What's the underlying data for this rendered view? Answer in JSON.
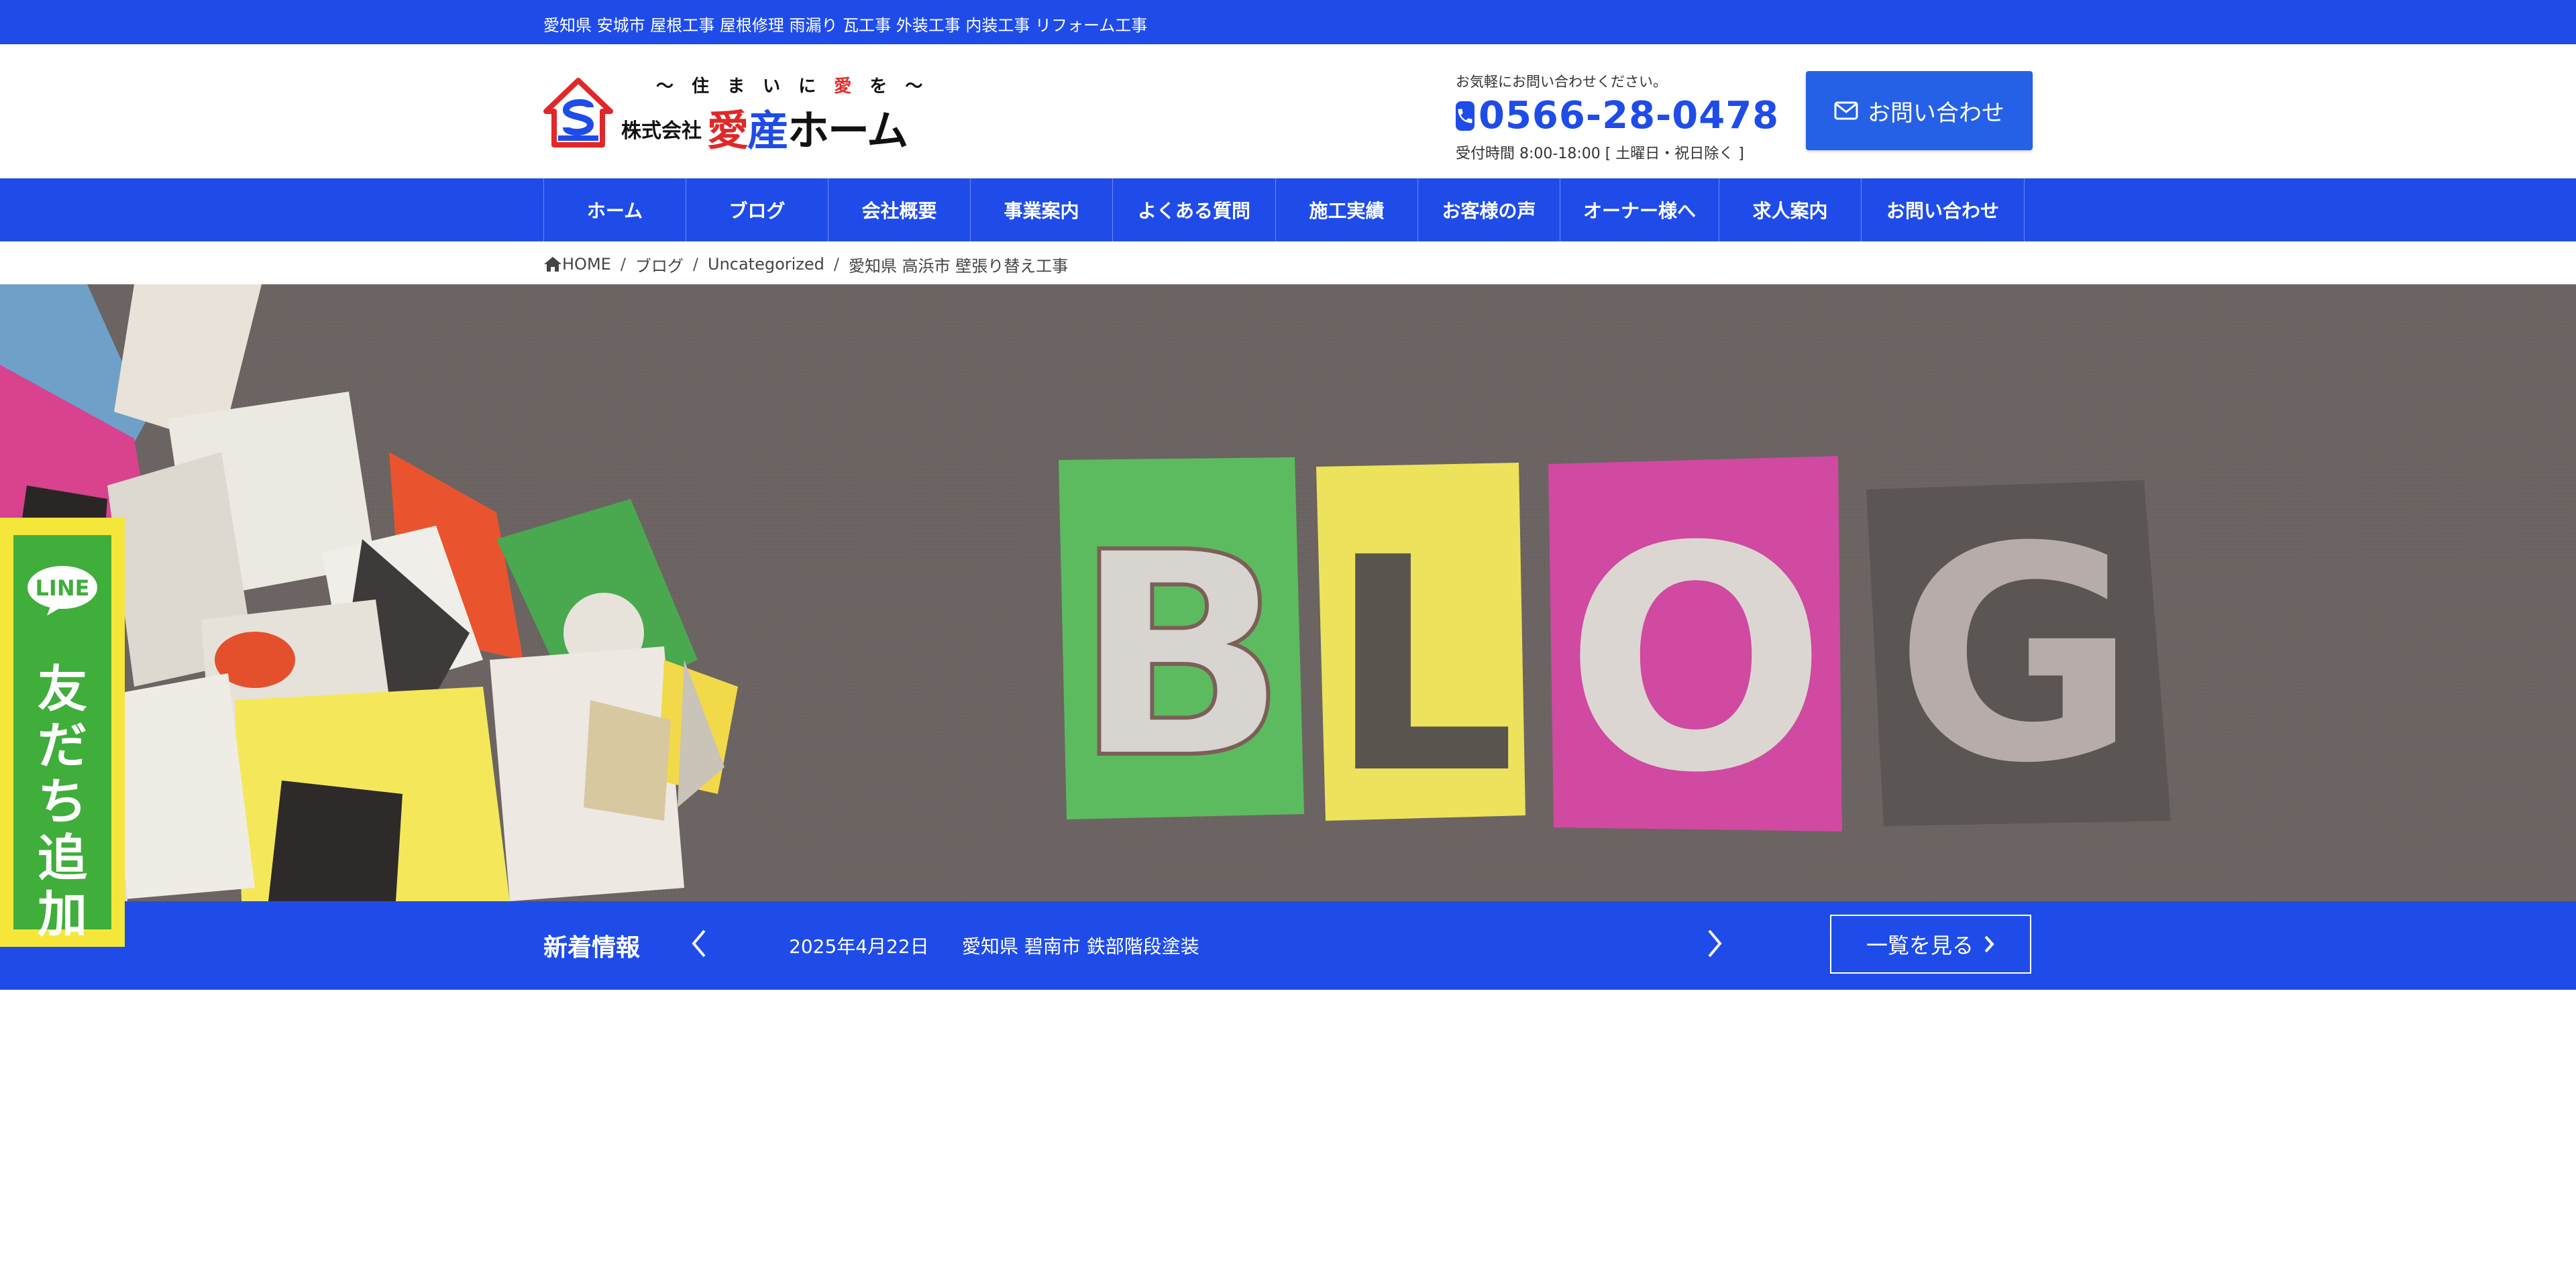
{
  "top_strip": {
    "text": "愛知県 安城市 屋根工事 屋根修理 雨漏り 瓦工事 外装工事 内装工事 リフォーム工事"
  },
  "logo": {
    "tagline_pre": "～ 住 ま い に ",
    "tagline_ai": "愛",
    "tagline_post": " を ～",
    "corp": "株式会社",
    "brand_1": "愛",
    "brand_2": "産",
    "brand_3": "ホーム"
  },
  "contact": {
    "note": "お気軽にお問い合わせください。",
    "phone": "0566-28-0478",
    "hours": "受付時間 8:00-18:00 [ 土曜日・祝日除く ]",
    "button_label": "お問い合わせ"
  },
  "nav": {
    "items": [
      {
        "label": "ホーム"
      },
      {
        "label": "ブログ"
      },
      {
        "label": "会社概要"
      },
      {
        "label": "事業案内"
      },
      {
        "label": "よくある質問"
      },
      {
        "label": "施工実績"
      },
      {
        "label": "お客様の声"
      },
      {
        "label": "オーナー様へ"
      },
      {
        "label": "求人案内"
      },
      {
        "label": "お問い合わせ"
      }
    ]
  },
  "breadcrumb": {
    "home": "HOME",
    "items": [
      "ブログ",
      "Uncategorized",
      "愛知県 高浜市 壁張り替え工事"
    ]
  },
  "hero": {
    "letters": [
      "B",
      "L",
      "O",
      "G"
    ]
  },
  "news": {
    "label": "新着情報",
    "date": "2025年4月22日",
    "title": "愛知県 碧南市 鉄部階段塗装",
    "more_label": "一覧を見る"
  },
  "line_banner": {
    "logo_text": "LINE",
    "text": "友だち追加"
  },
  "colors": {
    "brand_blue": "#1f4ce8",
    "button_blue": "#2561e6",
    "line_green": "#3fae3a",
    "line_yellow": "#f5e63a",
    "logo_red": "#e02828"
  }
}
